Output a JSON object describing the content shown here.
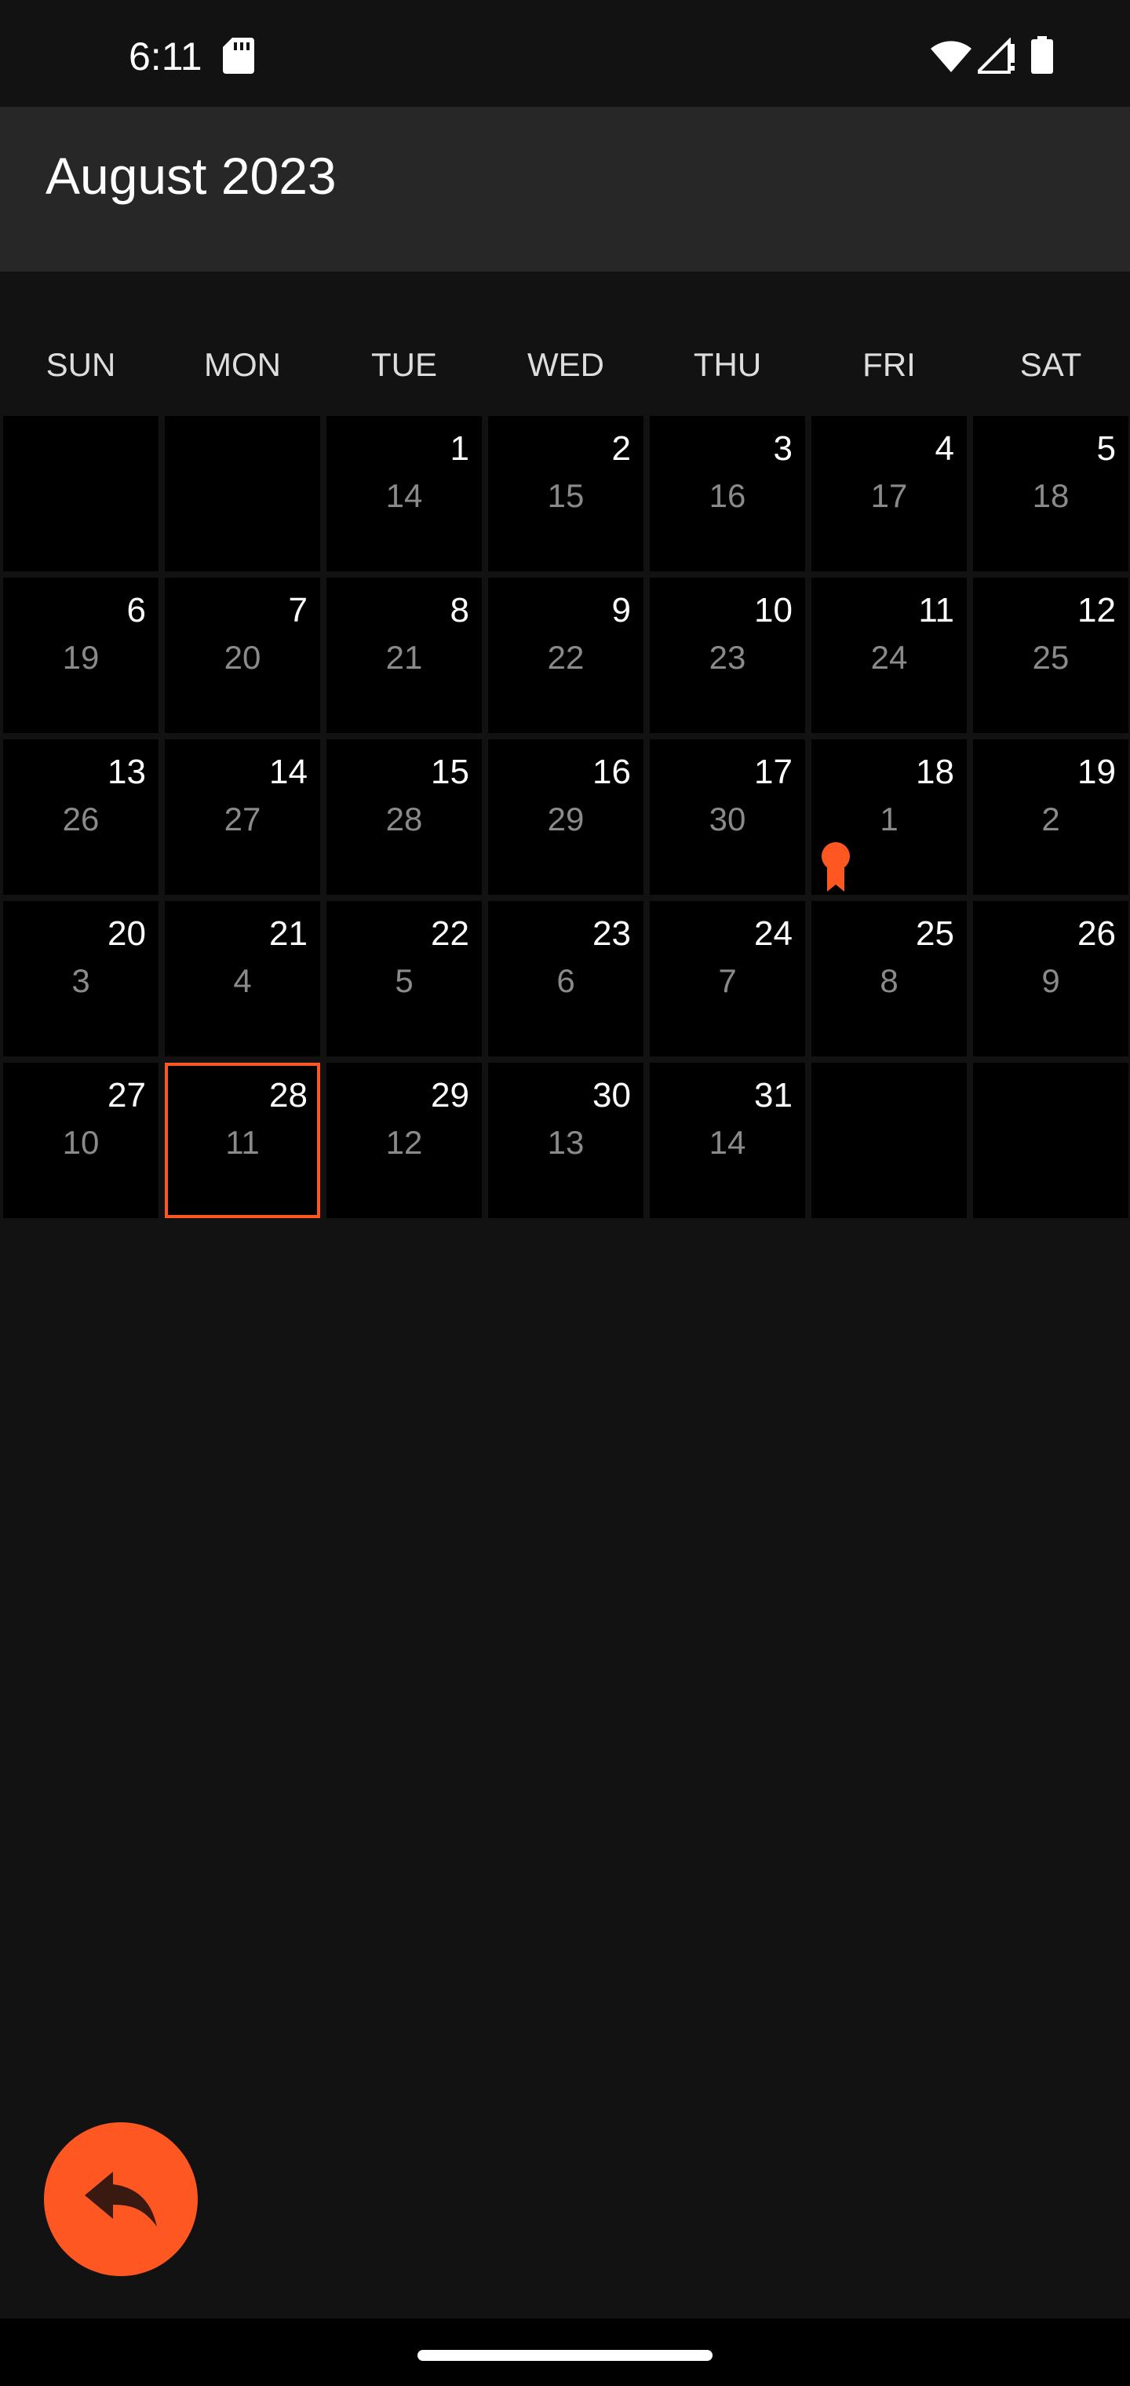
{
  "status_bar": {
    "time": "6:11",
    "icons": [
      "sd-card-icon",
      "wifi-icon",
      "signal-icon",
      "battery-icon"
    ]
  },
  "header": {
    "title": "August 2023"
  },
  "calendar": {
    "weekdays": [
      "SUN",
      "MON",
      "TUE",
      "WED",
      "THU",
      "FRI",
      "SAT"
    ],
    "weeks": [
      [
        null,
        null,
        {
          "day": "1",
          "lunar": "14"
        },
        {
          "day": "2",
          "lunar": "15"
        },
        {
          "day": "3",
          "lunar": "16"
        },
        {
          "day": "4",
          "lunar": "17"
        },
        {
          "day": "5",
          "lunar": "18"
        }
      ],
      [
        {
          "day": "6",
          "lunar": "19"
        },
        {
          "day": "7",
          "lunar": "20"
        },
        {
          "day": "8",
          "lunar": "21"
        },
        {
          "day": "9",
          "lunar": "22"
        },
        {
          "day": "10",
          "lunar": "23"
        },
        {
          "day": "11",
          "lunar": "24"
        },
        {
          "day": "12",
          "lunar": "25"
        }
      ],
      [
        {
          "day": "13",
          "lunar": "26"
        },
        {
          "day": "14",
          "lunar": "27"
        },
        {
          "day": "15",
          "lunar": "28"
        },
        {
          "day": "16",
          "lunar": "29"
        },
        {
          "day": "17",
          "lunar": "30"
        },
        {
          "day": "18",
          "lunar": "1",
          "marker": "award-ribbon-icon"
        },
        {
          "day": "19",
          "lunar": "2"
        }
      ],
      [
        {
          "day": "20",
          "lunar": "3"
        },
        {
          "day": "21",
          "lunar": "4"
        },
        {
          "day": "22",
          "lunar": "5"
        },
        {
          "day": "23",
          "lunar": "6"
        },
        {
          "day": "24",
          "lunar": "7"
        },
        {
          "day": "25",
          "lunar": "8"
        },
        {
          "day": "26",
          "lunar": "9"
        }
      ],
      [
        {
          "day": "27",
          "lunar": "10"
        },
        {
          "day": "28",
          "lunar": "11",
          "today": true
        },
        {
          "day": "29",
          "lunar": "12"
        },
        {
          "day": "30",
          "lunar": "13"
        },
        {
          "day": "31",
          "lunar": "14"
        },
        null,
        null
      ]
    ]
  },
  "fab": {
    "icon": "reply-arrow-icon"
  },
  "colors": {
    "accent": "#ff5722",
    "background": "#121212",
    "app_bar": "#272727",
    "cell": "#000000",
    "lunar_text": "#8a8a8a"
  }
}
